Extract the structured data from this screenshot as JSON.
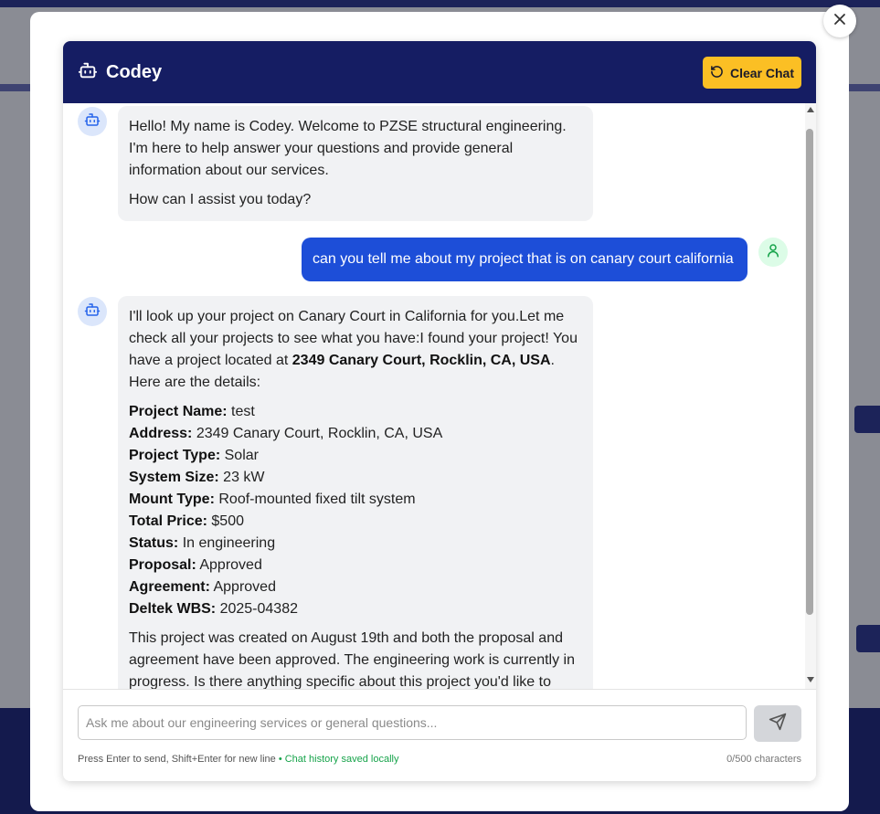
{
  "header": {
    "title": "Codey",
    "clear_label": "Clear Chat"
  },
  "messages": {
    "bot1": {
      "p1": "Hello! My name is Codey. Welcome to PZSE structural engineering. I'm here to help answer your questions and provide general information about our services.",
      "p2": "How can I assist you today?"
    },
    "user1": "can you tell me about my project that is on canary court california",
    "bot2": {
      "intro_a": "I'll look up your project on Canary Court in California for you.Let me check all your projects to see what you have:I found your project! You have a project located at ",
      "intro_bold": "2349 Canary Court, Rocklin, CA, USA",
      "intro_b": ". Here are the details:",
      "details": [
        {
          "label": "Project Name:",
          "value": "test"
        },
        {
          "label": "Address:",
          "value": "2349 Canary Court, Rocklin, CA, USA"
        },
        {
          "label": "Project Type:",
          "value": "Solar"
        },
        {
          "label": "System Size:",
          "value": "23 kW"
        },
        {
          "label": "Mount Type:",
          "value": "Roof-mounted fixed tilt system"
        },
        {
          "label": "Total Price:",
          "value": "$500"
        },
        {
          "label": "Status:",
          "value": "In engineering"
        },
        {
          "label": "Proposal:",
          "value": "Approved"
        },
        {
          "label": "Agreement:",
          "value": "Approved"
        },
        {
          "label": "Deltek WBS:",
          "value": "2025-04382"
        }
      ],
      "outro": "This project was created on August 19th and both the proposal and agreement have been approved. The engineering work is currently in progress. Is there anything specific about this project you'd like to know"
    }
  },
  "input": {
    "placeholder": "Ask me about our engineering services or general questions...",
    "value": ""
  },
  "footer": {
    "hint": "Press Enter to send, Shift+Enter for new line",
    "saved": "• Chat history saved locally",
    "counter": "0/500 characters"
  },
  "colors": {
    "header_bg": "#151d63",
    "accent_button": "#fbbf24",
    "user_bubble": "#1d4ed8",
    "bot_bubble": "#f1f2f4",
    "saved_text": "#16a34a"
  },
  "icons": {
    "close": "close-icon",
    "bot": "robot-icon",
    "user": "user-icon",
    "clear": "refresh-icon",
    "send": "send-icon"
  }
}
